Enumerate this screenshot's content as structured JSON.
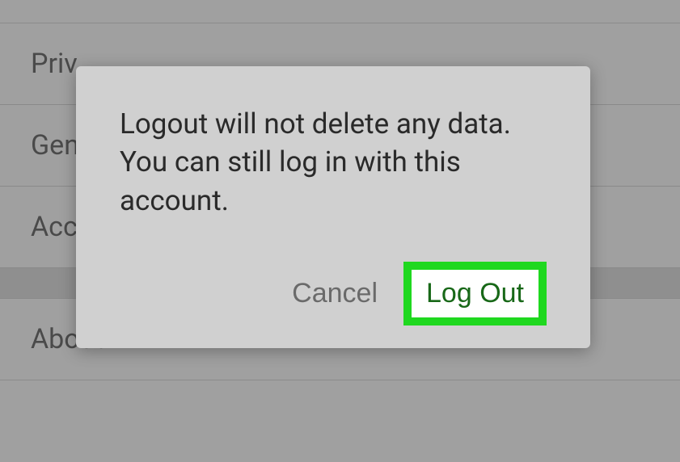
{
  "settings": {
    "items": [
      {
        "label": "Priv"
      },
      {
        "label": "Gen"
      },
      {
        "label": "Acc"
      },
      {
        "label": "About"
      }
    ]
  },
  "dialog": {
    "message": "Logout will not delete any data. You can still log in with this account.",
    "cancel_label": "Cancel",
    "logout_label": "Log Out"
  },
  "colors": {
    "highlight": "#1fd81f",
    "logout_text": "#186818"
  }
}
